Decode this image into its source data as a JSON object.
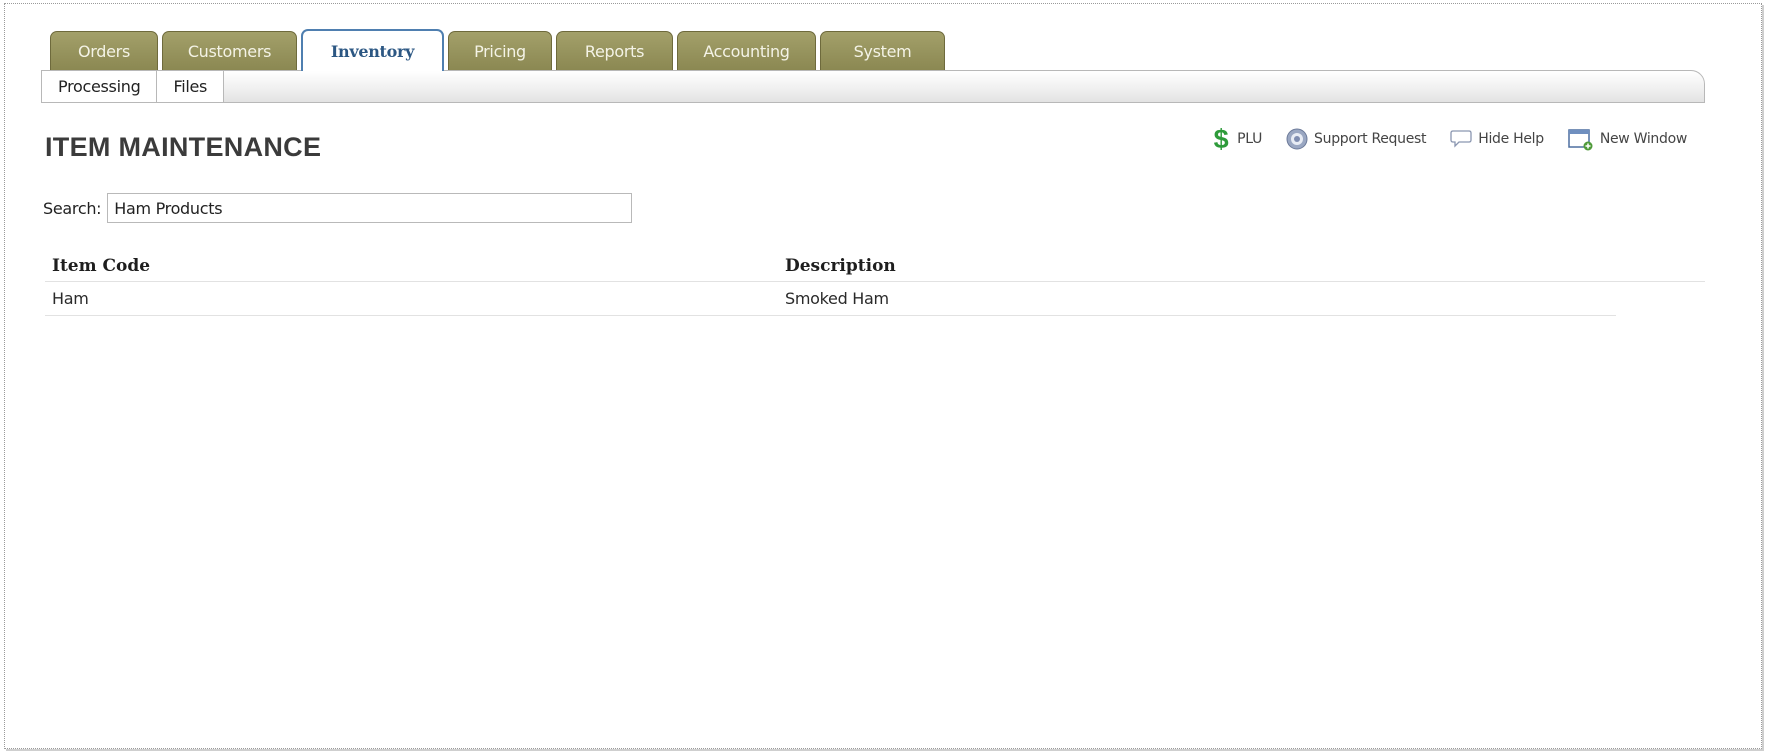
{
  "main_tabs": [
    {
      "label": "Orders",
      "active": false
    },
    {
      "label": "Customers",
      "active": false
    },
    {
      "label": "Inventory",
      "active": true
    },
    {
      "label": "Pricing",
      "active": false
    },
    {
      "label": "Reports",
      "active": false
    },
    {
      "label": "Accounting",
      "active": false
    },
    {
      "label": "System",
      "active": false
    }
  ],
  "sub_tabs": [
    {
      "label": "Processing"
    },
    {
      "label": "Files"
    }
  ],
  "page": {
    "title": "ITEM MAINTENANCE"
  },
  "help_links": {
    "plu": {
      "label": "PLU",
      "icon": "dollar-icon"
    },
    "support": {
      "label": "Support Request",
      "icon": "support-icon"
    },
    "help": {
      "label": "Hide Help",
      "icon": "speech-bubble-icon"
    },
    "window": {
      "label": "New Window",
      "icon": "new-window-icon"
    }
  },
  "search": {
    "label": "Search:",
    "value": "Ham Products"
  },
  "table": {
    "columns": [
      "Item Code",
      "Description"
    ],
    "rows": [
      {
        "item_code": "Ham",
        "description": "Smoked Ham"
      }
    ]
  },
  "colors": {
    "tab_olive": "#9a9760",
    "tab_active_border": "#4f7fb0",
    "dollar_green": "#2e9b3a"
  }
}
